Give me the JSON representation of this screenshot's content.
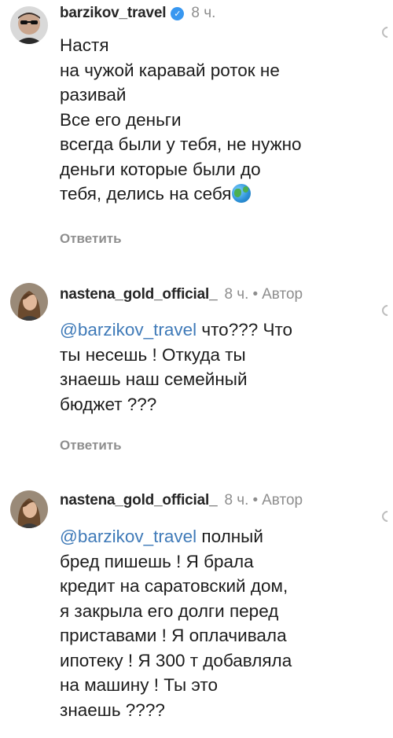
{
  "comments": [
    {
      "username": "barzikov_travel",
      "verified": true,
      "time": "8 ч.",
      "author_badge": "",
      "lines": [
        "Настя",
        "на чужой каравай роток не",
        "разивай",
        "Все его деньги",
        "всегда были у тебя, не нужно",
        "деньги которые были до",
        "тебя, делись на себя"
      ],
      "emoji": "globe-icon",
      "reply_label": "Ответить"
    },
    {
      "username": "nastena_gold_official_",
      "verified": false,
      "time": "8 ч.",
      "author_badge": "Автор",
      "mention": "@barzikov_travel",
      "lines": [
        " что??? Что",
        "ты несешь ! Откуда ты",
        "знаешь наш семейный",
        "бюджет ???"
      ],
      "reply_label": "Ответить"
    },
    {
      "username": "nastena_gold_official_",
      "verified": false,
      "time": "8 ч.",
      "author_badge": "Автор",
      "mention": "@barzikov_travel",
      "lines": [
        " полный",
        "бред пишешь ! Я брала",
        "кредит на саратовский дом,",
        "я закрыла его долги перед",
        "приставами ! Я оплачивала",
        "ипотеку ! Я 300 т добавляла",
        "на машину ! Ты это",
        "знаешь ????"
      ]
    }
  ]
}
